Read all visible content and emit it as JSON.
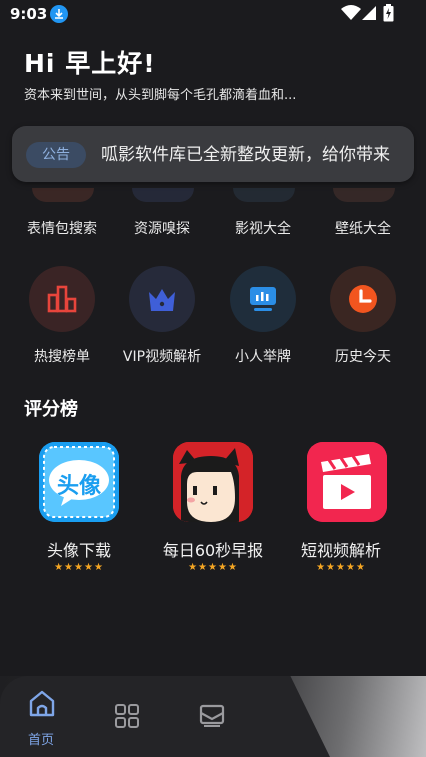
{
  "status": {
    "time": "9:03",
    "icons": [
      "download-icon",
      "wifi-icon",
      "signal-icon",
      "battery-charging-icon"
    ]
  },
  "header": {
    "greeting": "Hi 早上好!",
    "subtitle": "资本来到世间，从头到脚每个毛孔都滴着血和..."
  },
  "notice": {
    "tag": "公告",
    "text": "呱影软件库已全新整改更新，给你带来"
  },
  "grid": {
    "row1": [
      "表情包搜索",
      "资源嗅探",
      "影视大全",
      "壁纸大全"
    ],
    "row2": [
      "热搜榜单",
      "VIP视频解析",
      "小人举牌",
      "历史今天"
    ]
  },
  "ranking": {
    "title": "评分榜",
    "items": [
      {
        "name": "头像下载",
        "icon_text": "头像",
        "rating": 5
      },
      {
        "name": "每日60秒早报",
        "rating": 5
      },
      {
        "name": "短视频解析",
        "rating": 5
      }
    ]
  },
  "nav": {
    "home_label": "首页",
    "items": [
      "home-icon",
      "grid-apps-icon",
      "mail-icon"
    ]
  },
  "colors": {
    "accent": "#7fa6e8",
    "star": "#f5a623",
    "notice_tag_bg": "#3b4b63"
  }
}
